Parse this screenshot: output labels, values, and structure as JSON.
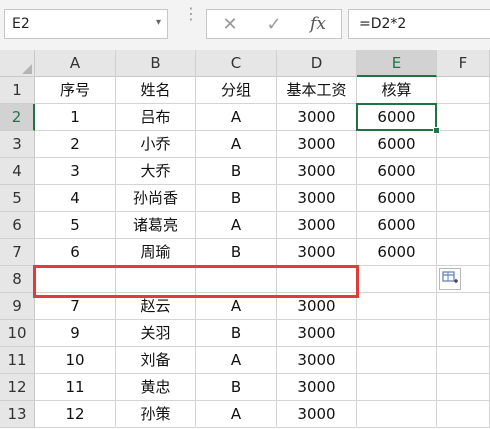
{
  "toolbar": {
    "name_box": "E2",
    "name_box_dropdown": "▾",
    "dots": "⋮",
    "cancel_icon": "✕",
    "enter_icon": "✓",
    "fx_label": "fx",
    "formula": "=D2*2"
  },
  "columns": [
    "A",
    "B",
    "C",
    "D",
    "E",
    "F"
  ],
  "rows": [
    "1",
    "2",
    "3",
    "4",
    "5",
    "6",
    "7",
    "8",
    "9",
    "10",
    "11",
    "12",
    "13"
  ],
  "cells": [
    [
      "序号",
      "姓名",
      "分组",
      "基本工资",
      "核算",
      ""
    ],
    [
      "1",
      "吕布",
      "A",
      "3000",
      "6000",
      ""
    ],
    [
      "2",
      "小乔",
      "A",
      "3000",
      "6000",
      ""
    ],
    [
      "3",
      "大乔",
      "B",
      "3000",
      "6000",
      ""
    ],
    [
      "4",
      "孙尚香",
      "B",
      "3000",
      "6000",
      ""
    ],
    [
      "5",
      "诸葛亮",
      "A",
      "3000",
      "6000",
      ""
    ],
    [
      "6",
      "周瑜",
      "B",
      "3000",
      "6000",
      ""
    ],
    [
      "",
      "",
      "",
      "",
      "",
      ""
    ],
    [
      "7",
      "赵云",
      "A",
      "3000",
      "",
      ""
    ],
    [
      "9",
      "关羽",
      "B",
      "3000",
      "",
      ""
    ],
    [
      "10",
      "刘备",
      "A",
      "3000",
      "",
      ""
    ],
    [
      "11",
      "黄忠",
      "B",
      "3000",
      "",
      ""
    ],
    [
      "12",
      "孙策",
      "A",
      "3000",
      "",
      ""
    ]
  ],
  "selected_cell": "E2",
  "colors": {
    "selection": "#217346",
    "highlight_box": "#e03c3c"
  }
}
